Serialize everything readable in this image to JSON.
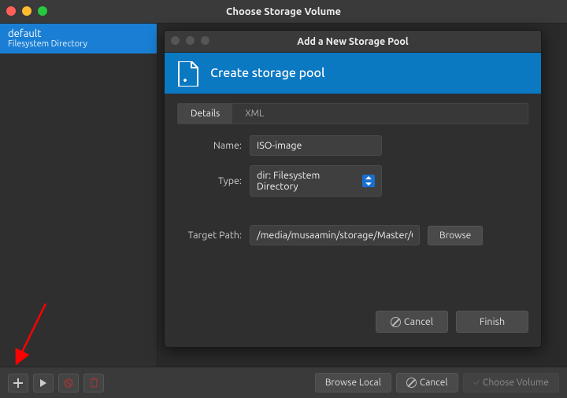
{
  "window": {
    "title": "Choose Storage Volume"
  },
  "sidebar": {
    "items": [
      {
        "name": "default",
        "sub": "Filesystem Directory"
      }
    ]
  },
  "footer": {
    "browse_local": "Browse Local",
    "cancel": "Cancel",
    "choose_volume": "Choose Volume"
  },
  "modal": {
    "title": "Add a New Storage Pool",
    "banner": "Create storage pool",
    "tabs": {
      "details": "Details",
      "xml": "XML"
    },
    "form": {
      "name_label": "Name:",
      "name_value": "ISO-image",
      "type_label": "Type:",
      "type_value": "dir: Filesystem Directory",
      "target_label": "Target Path:",
      "target_value": "/media/musaamin/storage/Master/Os/",
      "browse": "Browse"
    },
    "buttons": {
      "cancel": "Cancel",
      "finish": "Finish"
    }
  }
}
